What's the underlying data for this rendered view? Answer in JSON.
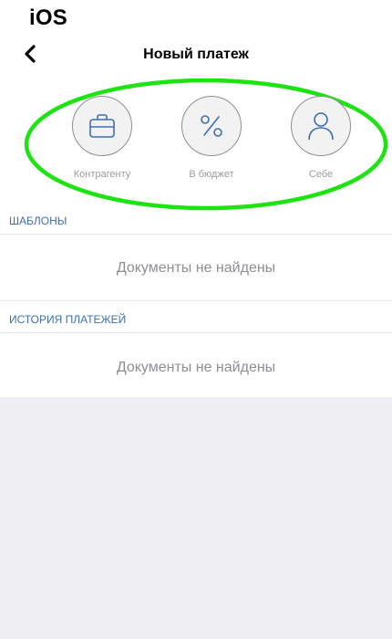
{
  "platform_label": "iOS",
  "header": {
    "title": "Новый платеж",
    "back_icon": "chevron-left-icon"
  },
  "quick_actions": [
    {
      "label": "Контрагенту",
      "icon": "briefcase-icon"
    },
    {
      "label": "В бюджет",
      "icon": "percent-icon"
    },
    {
      "label": "Себе",
      "icon": "person-icon"
    }
  ],
  "highlight_color": "#1de312",
  "accent_color": "#3a70b3",
  "sections": {
    "templates": {
      "header": "ШАБЛОНЫ",
      "empty_text": "Документы не найдены"
    },
    "history": {
      "header": "ИСТОРИЯ ПЛАТЕЖЕЙ",
      "empty_text": "Документы не найдены"
    }
  }
}
